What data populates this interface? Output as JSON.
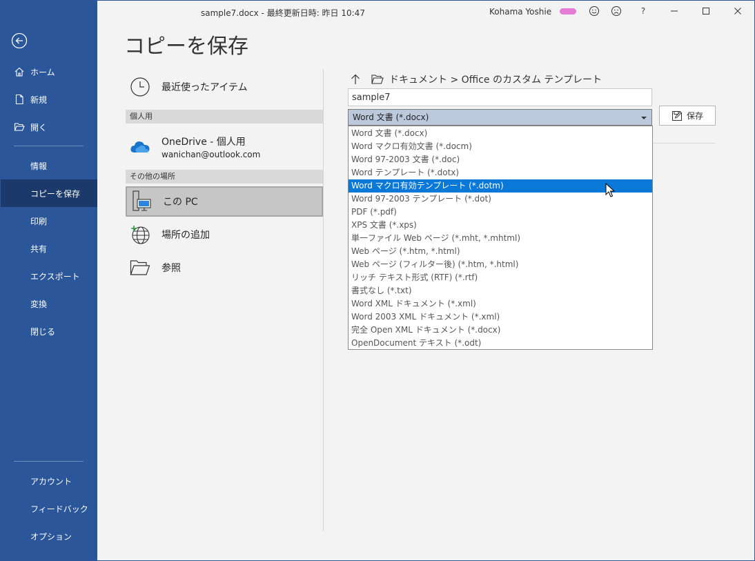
{
  "window": {
    "doc_title": "sample7.docx  -  最終更新日時: 昨日 10:47",
    "user_name": "Kohama Yoshie",
    "help": "?"
  },
  "colors": {
    "sidebar": "#2b579a",
    "active_nav": "#1b3a6b",
    "highlight": "#0a78d7"
  },
  "sidebar": {
    "back_icon": "back-arrow-icon",
    "top_items": [
      {
        "label": "ホーム",
        "icon": "home-icon"
      },
      {
        "label": "新規",
        "icon": "new-document-icon"
      },
      {
        "label": "開く",
        "icon": "open-folder-icon"
      }
    ],
    "mid_items": [
      {
        "label": "情報"
      },
      {
        "label": "コピーを保存",
        "active": true
      },
      {
        "label": "印刷"
      },
      {
        "label": "共有"
      },
      {
        "label": "エクスポート"
      },
      {
        "label": "変換"
      },
      {
        "label": "閉じる"
      }
    ],
    "bottom_items": [
      {
        "label": "アカウント"
      },
      {
        "label": "フィードバック"
      },
      {
        "label": "オプション"
      }
    ]
  },
  "page_title": "コピーを保存",
  "locations": {
    "recent": "最近使ったアイテム",
    "personal_header": "個人用",
    "onedrive_title": "OneDrive - 個人用",
    "onedrive_account": "wanichan@outlook.com",
    "other_header": "その他の場所",
    "this_pc": "この PC",
    "add_place": "場所の追加",
    "browse": "参照"
  },
  "save_panel": {
    "path": "ドキュメント > Office のカスタム テンプレート",
    "filename": "sample7",
    "selected_type": "Word 文書 (*.docx)",
    "save_label": "保存",
    "file_types": [
      "Word 文書 (*.docx)",
      "Word マクロ有効文書 (*.docm)",
      "Word 97-2003 文書 (*.doc)",
      "Word テンプレート (*.dotx)",
      "Word マクロ有効テンプレート (*.dotm)",
      "Word 97-2003 テンプレート (*.dot)",
      "PDF (*.pdf)",
      "XPS 文書 (*.xps)",
      "単一ファイル Web ページ (*.mht, *.mhtml)",
      "Web ページ (*.htm, *.html)",
      "Web ページ (フィルター後) (*.htm, *.html)",
      "リッチ テキスト形式 (RTF) (*.rtf)",
      "書式なし (*.txt)",
      "Word XML ドキュメント (*.xml)",
      "Word 2003 XML ドキュメント (*.xml)",
      "完全 Open XML ドキュメント (*.docx)",
      "OpenDocument テキスト (*.odt)"
    ],
    "highlighted_index": 4
  }
}
